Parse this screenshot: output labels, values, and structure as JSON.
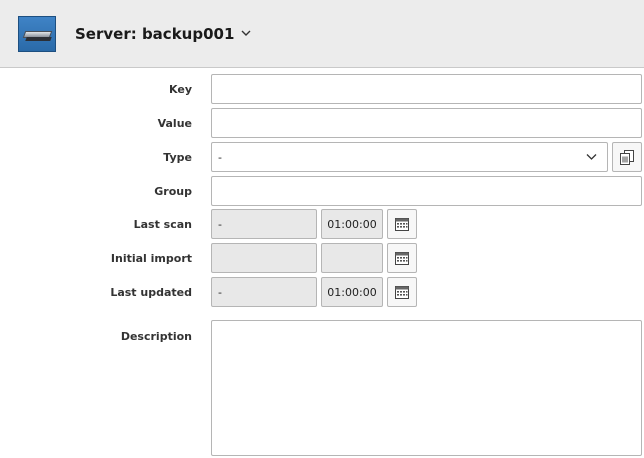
{
  "header": {
    "title": "Server: backup001",
    "icon": "server-icon",
    "dropdown_icon": "chevron-down-icon"
  },
  "form": {
    "key": {
      "label": "Key",
      "value": ""
    },
    "value": {
      "label": "Value",
      "value": ""
    },
    "type": {
      "label": "Type",
      "selected": "-",
      "copy_icon": "copy-icon"
    },
    "group": {
      "label": "Group",
      "value": ""
    },
    "last_scan": {
      "label": "Last scan",
      "date": "-",
      "time": "01:00:00",
      "icon": "calendar-icon"
    },
    "initial_import": {
      "label": "Initial import",
      "date": "",
      "time": "",
      "icon": "calendar-icon"
    },
    "last_updated": {
      "label": "Last updated",
      "date": "-",
      "time": "01:00:00",
      "icon": "calendar-icon"
    },
    "description": {
      "label": "Description",
      "value": ""
    }
  }
}
